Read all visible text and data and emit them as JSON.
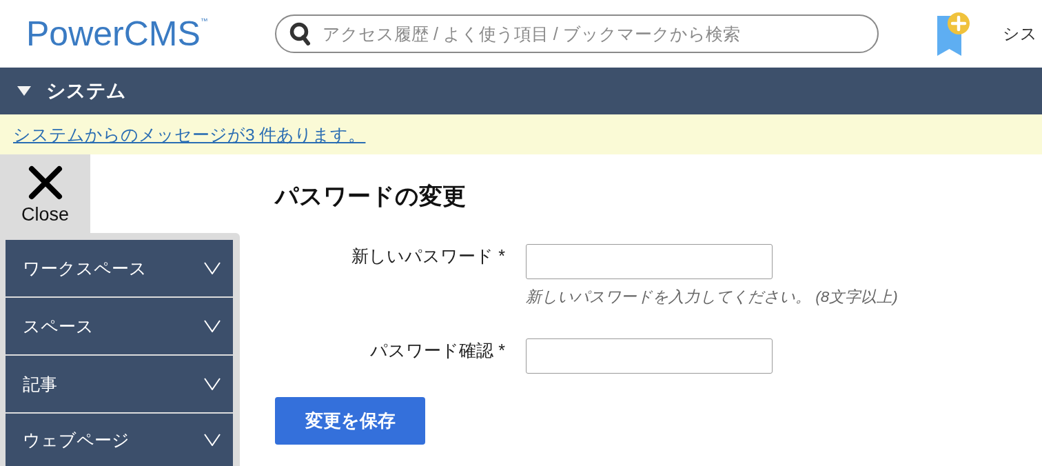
{
  "header": {
    "logo": "PowerCMS$^{™}$",
    "search": {
      "placeholder": "アクセス履歴 / よく使う項目 / ブックマークから検索"
    },
    "nav_label": "シス"
  },
  "section_bar": {
    "title": "システム",
    "expanded": true
  },
  "notice": {
    "link": "システムからのメッセージが3 件あります。"
  },
  "sidebar": {
    "close_label": "Close",
    "items": [
      {
        "label": "ワークスペース",
        "expanded": false
      },
      {
        "label": "スペース",
        "expanded": false
      },
      {
        "label": "記事",
        "expanded": false
      },
      {
        "label": "ウェブページ",
        "expanded": false
      }
    ]
  },
  "form": {
    "title": "パスワードの変更",
    "fields": [
      {
        "label": "新しいパスワード *",
        "hint": "新しいパスワードを入力してください。 (8文字以上)"
      },
      {
        "label": "パスワード確認 *"
      }
    ],
    "submit": "変更を保存"
  }
}
